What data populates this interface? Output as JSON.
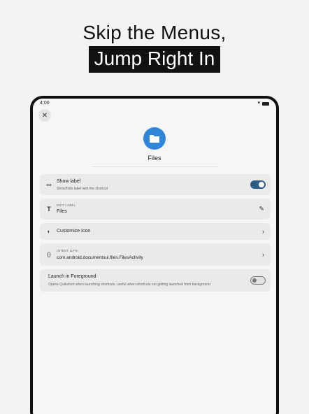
{
  "promo": {
    "line1": "Skip the Menus,",
    "line2": "Jump Right In"
  },
  "status_bar": {
    "time": "4:00",
    "icons": [
      "wifi-icon",
      "battery-icon"
    ]
  },
  "app": {
    "name": "Files",
    "icon": "folder-icon",
    "accent": "#2f86d8"
  },
  "settings": {
    "show_label": {
      "title": "Show label",
      "subtitle": "Show/hide label with the shortcut",
      "enabled": true,
      "icon": "label-icon"
    },
    "edit_label": {
      "caption": "EDIT LABEL",
      "value": "Files",
      "icon": "text-icon",
      "action_icon": "pencil-icon"
    },
    "customize_icon": {
      "title": "Customize Icon",
      "icon": "palette-icon",
      "action_icon": "chevron-right-icon"
    },
    "intent_data": {
      "caption": "INTENT DATA",
      "value": "com.android.documentsui.files.FilesActivity",
      "icon": "braces-icon",
      "action_icon": "chevron-right-icon"
    },
    "launch_foreground": {
      "title": "Launch in Foreground",
      "subtitle": "Opens Quikshort when launching shortcuts, useful when shortcuts not getting launched from background",
      "enabled": false
    }
  },
  "colors": {
    "toggle_on": "#2e5e86",
    "card_bg": "#eaeaea"
  }
}
